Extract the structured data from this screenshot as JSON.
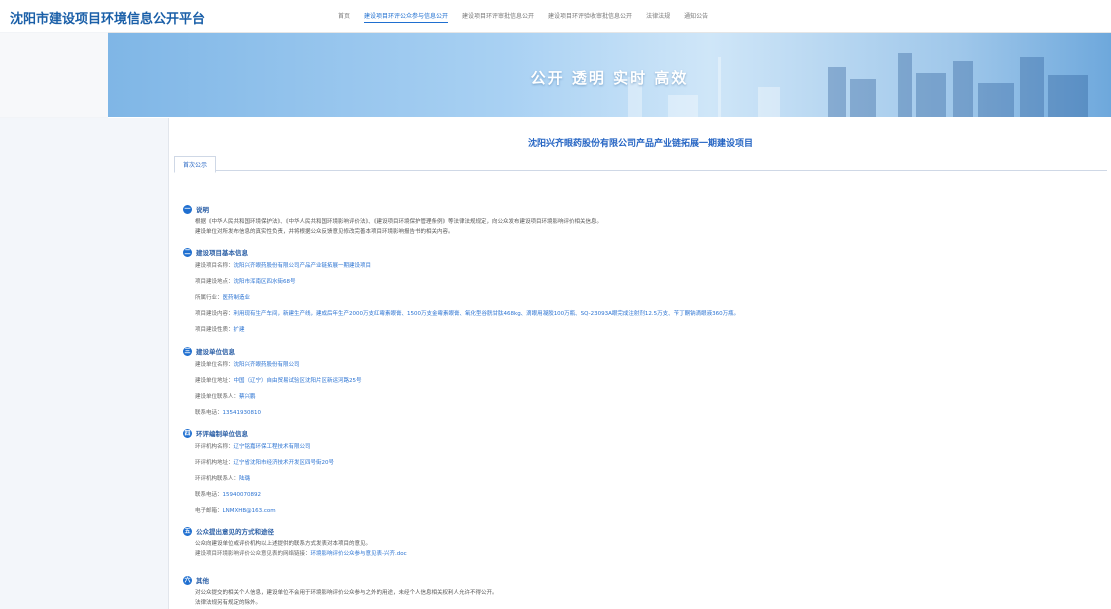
{
  "header": {
    "logo": "沈阳市建设项目环境信息公开平台",
    "nav": [
      "首页",
      "建设项目环评公众参与信息公开",
      "建设项目环评审批信息公开",
      "建设项目环评验收审批信息公开",
      "法律法规",
      "通知公告"
    ]
  },
  "banner": {
    "slogan": "公开 透明 实时 高效"
  },
  "project": {
    "title": "沈阳兴齐眼药股份有限公司产品产业链拓展一期建设项目",
    "tab": "首次公示"
  },
  "sections": {
    "s1": {
      "num": "一",
      "title": "说明",
      "lines": [
        "根据《中华人民共和国环境保护法》、《中华人民共和国环境影响评价法》、《建设项目环境保护管理条例》等法律法规规定，向公众发布建设项目环境影响评价相关信息。",
        "建设单位对所发布信息的真实性负责，并将根据公众反馈意见修改完善本项目环境影响报告书的相关内容。"
      ]
    },
    "s2": {
      "num": "二",
      "title": "建设项目基本信息",
      "items": [
        {
          "label": "建设项目名称：",
          "value": "沈阳兴齐眼药股份有限公司产品产业链拓展一期建设项目"
        },
        {
          "label": "项目建设地点：",
          "value": "沈阳市浑南区四水街68号"
        },
        {
          "label": "所属行业：",
          "value": "医药制造业"
        },
        {
          "label": "项目建设内容：",
          "value": "利用现有生产车间，新建生产线，建成后年生产2000万支红霉素眼膏、1500万支金霉素眼膏、氧化型谷胱甘肽468kg、滴眼用凝胶100万瓶、SQ-23093A眼完成注射剂12.5万支、苄丁酮钠滴眼液360万瓶。"
        },
        {
          "label": "项目建设性质：",
          "value": "扩建"
        }
      ]
    },
    "s3": {
      "num": "三",
      "title": "建设单位信息",
      "items": [
        {
          "label": "建设单位名称：",
          "value": "沈阳兴齐眼药股份有限公司"
        },
        {
          "label": "建设单位地址：",
          "value": "中国（辽宁）自由贸易试验区沈阳片区新运河路25号"
        },
        {
          "label": "建设单位联系人：",
          "value": "蔡兴鹏"
        },
        {
          "label": "联系电话：",
          "value": "13541930810"
        }
      ]
    },
    "s4": {
      "num": "四",
      "title": "环评编制单位信息",
      "items": [
        {
          "label": "环评机构名称：",
          "value": "辽宁铭嘉环保工程技术有限公司"
        },
        {
          "label": "环评机构地址：",
          "value": "辽宁省沈阳市经济技术开发区四号街20号"
        },
        {
          "label": "环评机构联系人：",
          "value": "陆璐"
        },
        {
          "label": "联系电话：",
          "value": "15940070892"
        },
        {
          "label": "电子邮箱：",
          "value": "LNMXHB@163.com"
        }
      ]
    },
    "s5": {
      "num": "五",
      "title": "公众提出意见的方式和途径",
      "line1": "公众向建设单位或评价机构以上述提供的联系方式发表对本项目的意见。",
      "line2_label": "建设项目环境影响评价公众意见表的网络链接：",
      "line2_link": "环境影响评价公众参与意见表-兴齐.doc"
    },
    "s6": {
      "num": "六",
      "title": "其他",
      "lines": [
        "对公众提交的相关个人信息，建设单位不会用于环境影响评价公众参与之外的用途，未经个人信息相关权利人允许不得公开。",
        "法律法规另有规定的除外。"
      ]
    }
  },
  "colors": {
    "accent": "#1f6fd0",
    "link": "#2b73d2",
    "title": "#2766c4"
  }
}
